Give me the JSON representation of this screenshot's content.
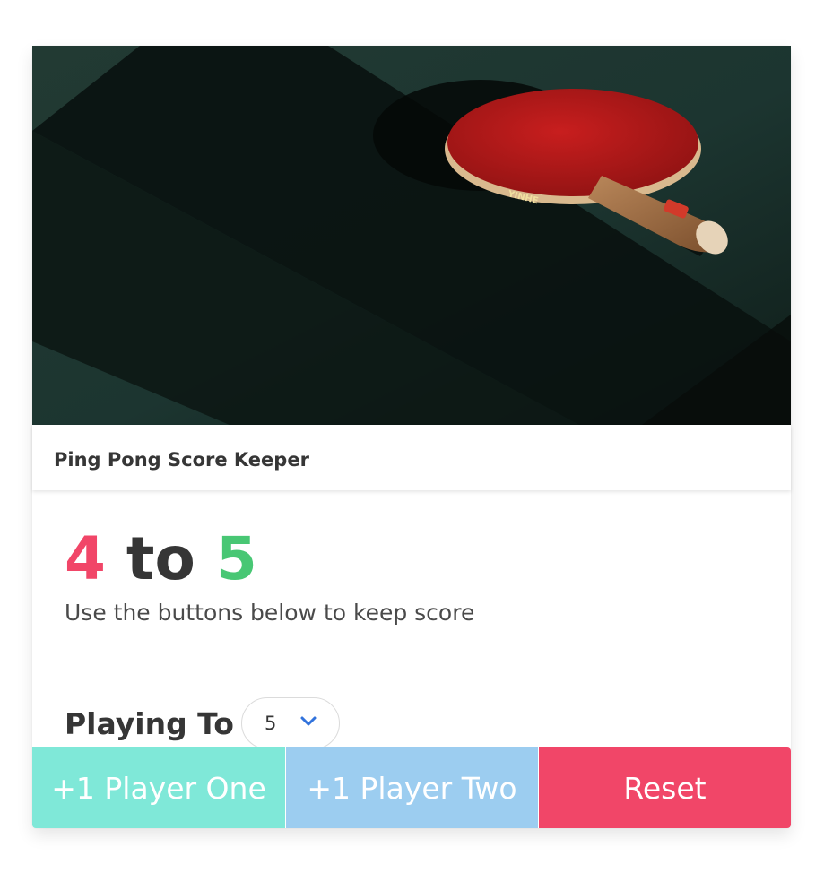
{
  "card": {
    "header_title": "Ping Pong Score Keeper",
    "image_icon": "ping-pong-paddle-photo"
  },
  "score": {
    "player_one": "4",
    "separator": "to",
    "player_two": "5",
    "subtitle": "Use the buttons below to keep score"
  },
  "playing_to": {
    "label": "Playing To",
    "selected_value": "5",
    "chevron_icon": "chevron-down-icon"
  },
  "buttons": {
    "player_one": "+1 Player One",
    "player_two": "+1 Player Two",
    "reset": "Reset"
  },
  "colors": {
    "player_one_score": "#f14668",
    "player_two_score": "#48c774",
    "player_one_button": "#7fe8d8",
    "player_two_button": "#9ccdf0",
    "reset_button": "#f14668",
    "chevron": "#3273dc"
  }
}
